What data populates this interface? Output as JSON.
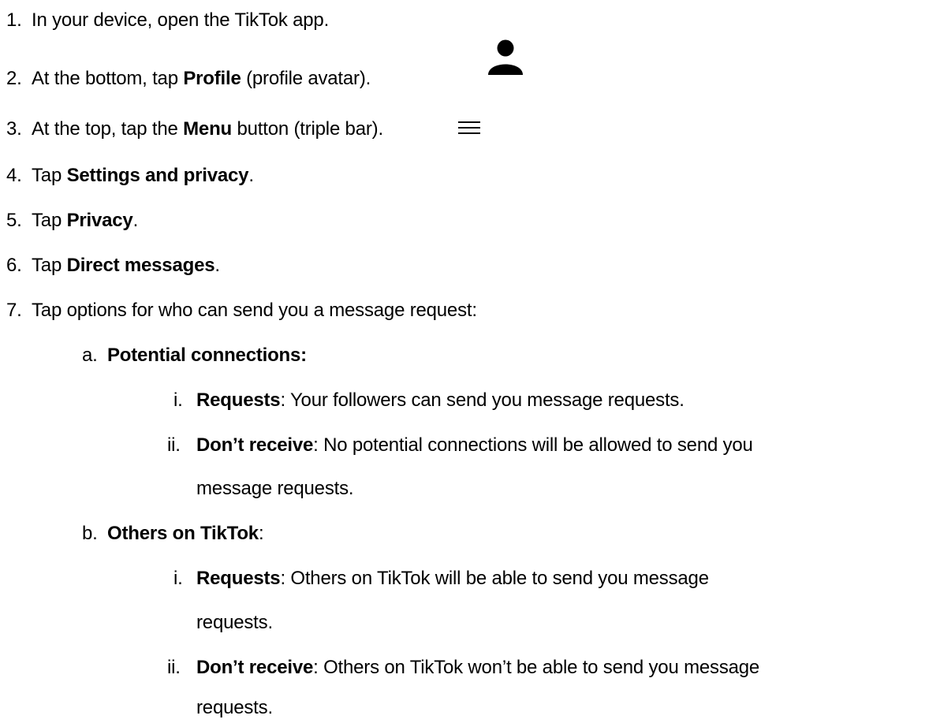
{
  "steps": [
    {
      "num": "1.",
      "parts": [
        "In your device, open the TikTok app."
      ]
    },
    {
      "num": "2.",
      "pre": "At the bottom, tap ",
      "bold": "Profile",
      "post": " (profile avatar).",
      "icon": "person-icon"
    },
    {
      "num": "3.",
      "pre": "At the top, tap the ",
      "bold": "Menu",
      "post": " button (triple bar).",
      "icon": "hamburger-menu-icon"
    },
    {
      "num": "4.",
      "pre": "Tap ",
      "bold": "Settings and privacy",
      "post": "."
    },
    {
      "num": "5.",
      "pre": "Tap ",
      "bold": "Privacy",
      "post": "."
    },
    {
      "num": "6.",
      "pre": "Tap ",
      "bold": "Direct messages",
      "post": "."
    },
    {
      "num": "7.",
      "text": "Tap options for who can send you a message request:"
    }
  ],
  "sub_a": {
    "num": "a.",
    "bold": "Potential connections:",
    "items": [
      {
        "num": "i.",
        "bold": "Requests",
        "post": ": Your followers can send you message requests."
      },
      {
        "num": "ii.",
        "bold": "Don’t receive",
        "post": ": No potential connections will be allowed to send you",
        "cont": "message requests."
      }
    ]
  },
  "sub_b": {
    "num": "b.",
    "bold": "Others on TikTok",
    "post": ":",
    "items": [
      {
        "num": "i.",
        "bold": "Requests",
        "post": ": Others on TikTok will be able to send you message",
        "cont": "requests."
      },
      {
        "num": "ii.",
        "bold": "Don’t receive",
        "post": ": Others on TikTok won’t be able to send you message",
        "cont": "requests."
      }
    ]
  }
}
